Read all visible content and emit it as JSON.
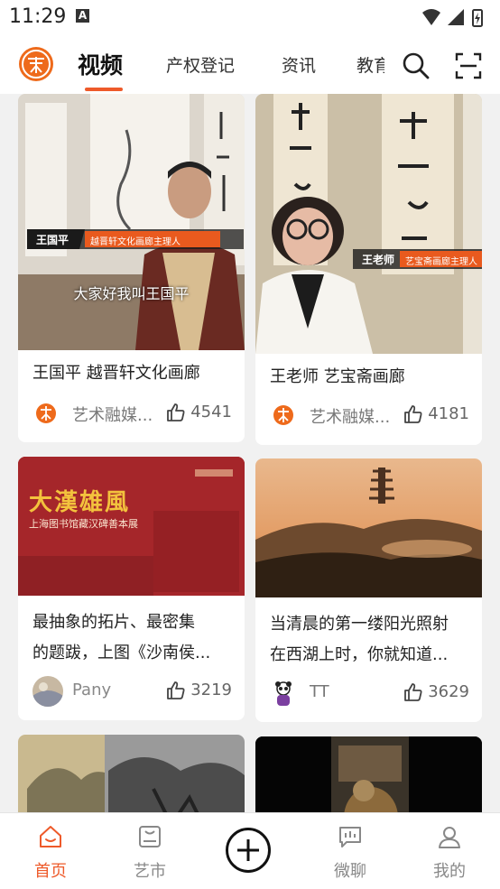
{
  "status_bar": {
    "time": "11:29",
    "notification_icon": "A"
  },
  "header": {
    "tabs": [
      {
        "label": "视频"
      },
      {
        "label": "产权登记"
      },
      {
        "label": "资讯"
      },
      {
        "label": "教育"
      }
    ],
    "icons": [
      "search-icon",
      "scan-icon"
    ]
  },
  "feed": [
    {
      "title": "王国平 越晋轩文化画廊",
      "overlay_name": "王国平",
      "overlay_role": "越晋轩文化画廊主理人",
      "subtitle": "大家好我叫王国平",
      "author": "艺术融媒...",
      "likes": "4541"
    },
    {
      "title": "王老师 艺宝斋画廊",
      "overlay_name": "王老师",
      "overlay_role": "艺宝斋画廊主理人",
      "author": "艺术融媒...",
      "likes": "4181"
    },
    {
      "title_line1": "最抽象的拓片、最密集",
      "title_line2": "的题跋，上图《沙南侯...",
      "banner_title": "大漢雄風",
      "banner_subtitle": "上海图书馆藏汉碑善本展",
      "author": "Pany",
      "likes": "3219"
    },
    {
      "title_line1": "当清晨的第一缕阳光照射",
      "title_line2": "在西湖上时，你就知道...",
      "author": "TT",
      "likes": "3629"
    }
  ],
  "bottom_nav": [
    {
      "label": "首页",
      "icon": "home-icon",
      "active": true
    },
    {
      "label": "艺市",
      "icon": "market-icon",
      "active": false
    },
    {
      "label": "",
      "icon": "plus-icon",
      "active": false
    },
    {
      "label": "微聊",
      "icon": "chat-icon",
      "active": false
    },
    {
      "label": "我的",
      "icon": "profile-icon",
      "active": false
    }
  ],
  "colors": {
    "accent": "#ee5a2a",
    "brand": "#ee6a1b"
  }
}
